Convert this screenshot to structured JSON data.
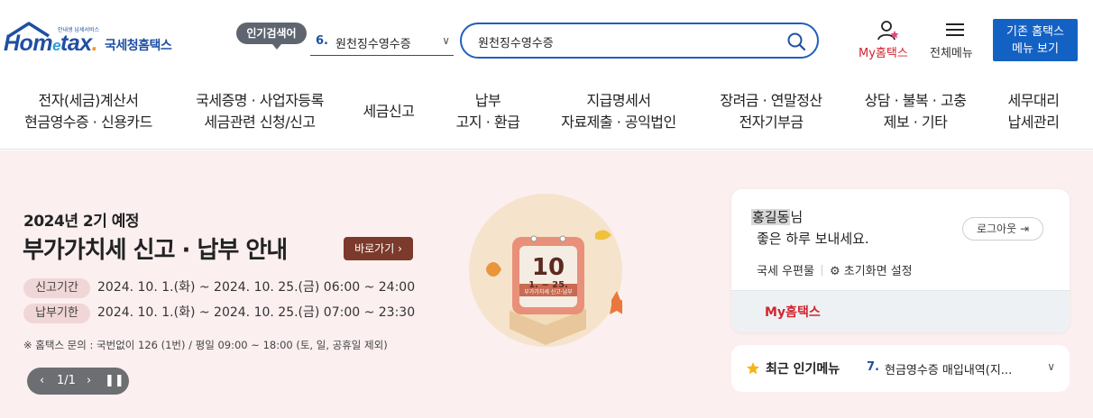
{
  "header": {
    "logo": {
      "tagline": "안내생 납세서비스",
      "wordmark_a": "Hom",
      "wordmark_e": "e",
      "wordmark_b": "tax",
      "agency": "국세청홈택스"
    },
    "popular_badge": "인기검색어",
    "popular_select": {
      "rank": "6.",
      "text": "원천징수영수증"
    },
    "search": {
      "value": "원천징수영수증"
    },
    "my_hometax_label": "My홈택스",
    "all_menu_label": "전체메뉴",
    "old_site_label_1": "기존 홈택스",
    "old_site_label_2": "메뉴 보기",
    "colors": {
      "brand": "#1f4fa3",
      "accent_red": "#d1262f",
      "button_blue": "#1461c4"
    },
    "icons": [
      "search-icon",
      "user-icon",
      "menu-icon"
    ]
  },
  "gnb": [
    {
      "line1": "전자(세금)계산서",
      "line2": "현금영수증 · 신용카드"
    },
    {
      "line1": "국세증명 · 사업자등록",
      "line2": "세금관련 신청/신고"
    },
    {
      "line1": "세금신고",
      "line2": ""
    },
    {
      "line1": "납부",
      "line2": "고지 · 환급"
    },
    {
      "line1": "지급명세서",
      "line2": "자료제출 · 공익법인"
    },
    {
      "line1": "장려금 · 연말정산",
      "line2": "전자기부금"
    },
    {
      "line1": "상담 · 불복 · 고충",
      "line2": "제보 · 기타"
    },
    {
      "line1": "세무대리",
      "line2": "납세관리"
    }
  ],
  "banner": {
    "subtitle": "2024년 2기 예정",
    "title": "부가가치세 신고 · 납부 안내",
    "go_button": "바로가기",
    "rows": [
      {
        "tag": "신고기간",
        "text": "2024. 10. 1.(화) ~ 2024. 10. 25.(금) 06:00 ~ 24:00"
      },
      {
        "tag": "납부기한",
        "text": "2024. 10. 1.(화) ~ 2024. 10. 25.(금) 07:00 ~ 23:30"
      }
    ],
    "note": "※ 홈택스 문의 : 국번없이 126 (1번) / 평일 09:00 ~ 18:00 (토, 일, 공휴일 제외)",
    "pager": "1/1",
    "calendar": {
      "big": "10",
      "range": "1. ~ 25.",
      "caption": "부가가치세 신고·납부"
    },
    "background": "#fbeff0"
  },
  "user_card": {
    "name": "홍길동",
    "suffix": "님",
    "greeting": "좋은 하루 보내세요.",
    "logout": "로그아웃",
    "link1": "국세 우편물",
    "link2": "초기화면 설정",
    "my_hometax": "My홈택스"
  },
  "recent": {
    "title": "최근 인기메뉴",
    "rank": "7.",
    "text": "현금영수증 매입내역(지..."
  }
}
